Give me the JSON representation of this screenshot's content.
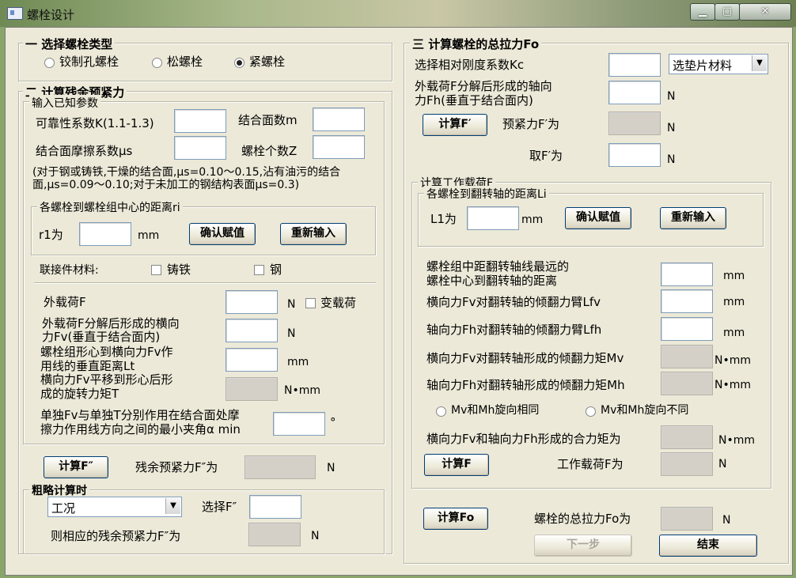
{
  "window": {
    "title": "螺栓设计",
    "min": "▁",
    "max": "▢",
    "close": "✕"
  },
  "section1": {
    "title": "一 选择螺栓类型",
    "options": [
      "铰制孔螺栓",
      "松螺栓",
      "紧螺栓"
    ],
    "selected": "紧螺栓"
  },
  "section2": {
    "title": "二 计算残余预紧力",
    "known_title": "输入已知参数",
    "k_label": "可靠性系数K(1.1-1.3)",
    "m_label": "结合面数m",
    "mu_label": "结合面摩擦系数μs",
    "z_label": "螺栓个数Z",
    "note_line1": "(对于钢或铸铁,干燥的结合面,μs=0.10～0.15,沾有油污的结合",
    "note_line2": "面,μs=0.09～0.10;对于未加工的钢结构表面μs=0.3)",
    "ri_group_title": "各螺栓到螺栓组中心的距离ri",
    "r1_label": "r1为",
    "r1_unit": "mm",
    "confirm": "确认赋值",
    "reinput": "重新输入",
    "material_label": "联接件材料:",
    "cast_iron": "铸铁",
    "steel": "钢",
    "load_label": "外载荷F",
    "load_unit": "N",
    "variable_load": "变载荷",
    "fv_label1": "外载荷F分解后形成的横向",
    "fv_label2": "力Fv(垂直于结合面内)",
    "fv_unit": "N",
    "lt_label1": "螺栓组形心到横向力Fv作",
    "lt_label2": "用线的垂直距离Lt",
    "lt_unit": "mm",
    "t_label1": "横向力Fv平移到形心后形",
    "t_label2": "成的旋转力矩T",
    "t_unit": "N•mm",
    "angle_label1": "单独Fv与单独T分别作用在结合面处摩",
    "angle_label2": "擦力作用线方向之间的最小夹角α min",
    "angle_unit": "°",
    "calc_btn": "计算F″",
    "residual_label": "残余预紧力F″为",
    "residual_unit": "N",
    "rough_title": "粗略计算时",
    "condition_select": "工况",
    "select_f_label": "选择F″",
    "corr_label": "则相应的残余预紧力F″为",
    "corr_unit": "N"
  },
  "section3": {
    "title": "三 计算螺栓的总拉力Fo",
    "kc_label": "选择相对刚度系数Kc",
    "gasket_select": "选垫片材料",
    "fh_label1": "外载荷F分解后形成的轴向",
    "fh_label2": "力Fh(垂直于结合面内)",
    "fh_unit": "N",
    "calc_fp_btn": "计算F′",
    "pretension_label": "预紧力F′为",
    "pretension_unit": "N",
    "take_label": "取F′为",
    "take_unit": "N",
    "work_group_title": "计算工作载荷F",
    "li_group_title": "各螺栓到翻转轴的距离Li",
    "l1_label": "L1为",
    "l1_unit": "mm",
    "confirm": "确认赋值",
    "reinput": "重新输入",
    "far_label1": "螺栓组中距翻转轴线最远的",
    "far_label2": "螺栓中心到翻转轴的距离",
    "far_unit": "mm",
    "lfv_label": "横向力Fv对翻转轴的倾翻力臂Lfv",
    "lfv_unit": "mm",
    "lfh_label": "轴向力Fh对翻转轴的倾翻力臂Lfh",
    "lfh_unit": "mm",
    "mv_label": "横向力Fv对翻转轴形成的倾翻力矩Mv",
    "mv_unit": "N•mm",
    "mh_label": "轴向力Fh对翻转轴形成的倾翻力矩Mh",
    "mh_unit": "N•mm",
    "same_dir": "Mv和Mh旋向相同",
    "diff_dir": "Mv和Mh旋向不同",
    "resultant_label": "横向力Fv和轴向力Fh形成的合力矩为",
    "resultant_unit": "N•mm",
    "calc_f_btn": "计算F",
    "work_load_label": "工作载荷F为",
    "work_load_unit": "N",
    "calc_fo_btn": "计算Fo",
    "total_label": "螺栓的总拉力Fo为",
    "total_unit": "N",
    "next_btn": "下一步",
    "end_btn": "结束"
  }
}
